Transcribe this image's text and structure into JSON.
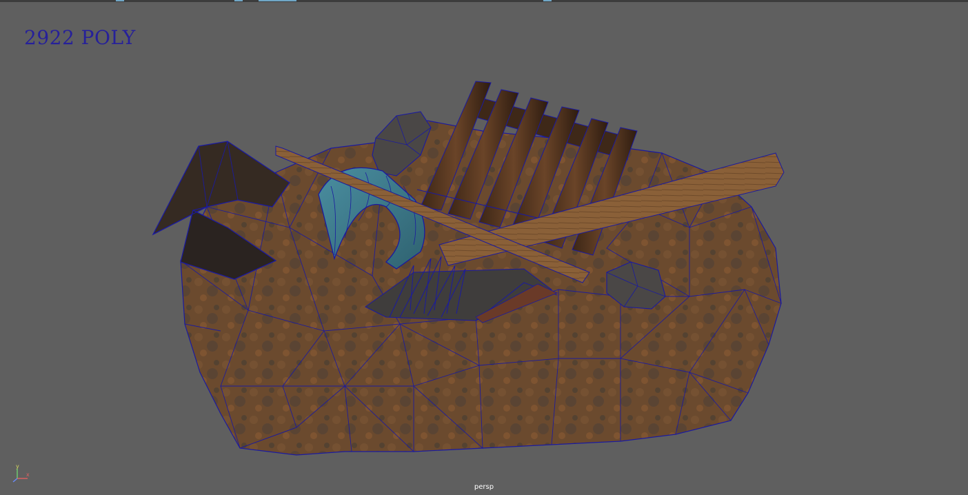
{
  "viewport": {
    "poly_count_label": "2922 POLY",
    "camera_label": "persp",
    "axis": {
      "y_label": "y",
      "x_label": "x"
    }
  },
  "colors": {
    "background": "#5f5f5f",
    "wireframe": "#1a1aa0",
    "poly_label": "#26209a",
    "rock": "#6b4a2e",
    "wood": "#5a3a22",
    "plank": "#8a6038",
    "barrel": "#3f7d8c"
  },
  "icons": [
    "axis-gizmo-icon"
  ]
}
